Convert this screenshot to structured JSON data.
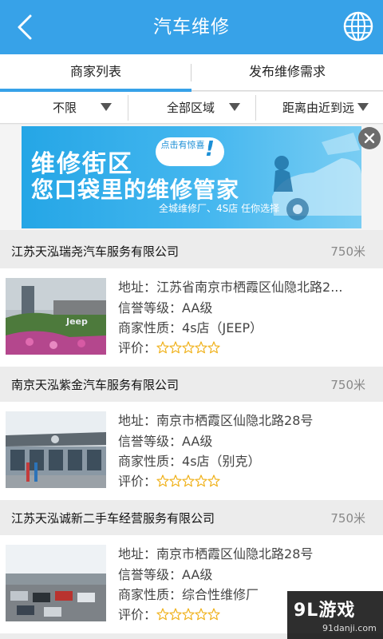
{
  "header": {
    "title": "汽车维修",
    "back_icon": "back-arrow-icon",
    "globe_icon": "globe-icon",
    "color": "#37a2e8"
  },
  "tabs": [
    {
      "label": "商家列表",
      "active": true
    },
    {
      "label": "发布维修需求",
      "active": false
    }
  ],
  "filters": [
    {
      "label": "不限"
    },
    {
      "label": "全部区域"
    },
    {
      "label": "距离由近到远"
    }
  ],
  "banner": {
    "line1": "维修街区",
    "line2": "您口袋里的维修管家",
    "bubble": "点击有惊喜",
    "bubble_mark": "!",
    "sub": "全城维修厂、4S店 任你选择"
  },
  "merchants": [
    {
      "name": "江苏天泓瑞尧汽车服务有限公司",
      "distance": "750米",
      "address_label": "地址：",
      "address": "江苏省南京市栖霞区仙隐北路2...",
      "credit_label": "信誉等级：",
      "credit": "AA级",
      "type_label": "商家性质：",
      "type": "4s店（JEEP）",
      "rating_label": "评价：",
      "rating": 0,
      "sign_text": "Jeep"
    },
    {
      "name": "南京天泓紫金汽车服务有限公司",
      "distance": "750米",
      "address_label": "地址：",
      "address": "南京市栖霞区仙隐北路28号",
      "credit_label": "信誉等级：",
      "credit": "AA级",
      "type_label": "商家性质：",
      "type": "4s店（别克）",
      "rating_label": "评价：",
      "rating": 0,
      "sign_text": ""
    },
    {
      "name": "江苏天泓诚新二手车经营服务有限公司",
      "distance": "750米",
      "address_label": "地址：",
      "address": "南京市栖霞区仙隐北路28号",
      "credit_label": "信誉等级：",
      "credit": "AA级",
      "type_label": "商家性质：",
      "type": "综合性维修厂",
      "rating_label": "评价：",
      "rating": 0,
      "sign_text": ""
    }
  ],
  "watermark": {
    "logo": "9L游戏",
    "url": "91danji.com"
  }
}
